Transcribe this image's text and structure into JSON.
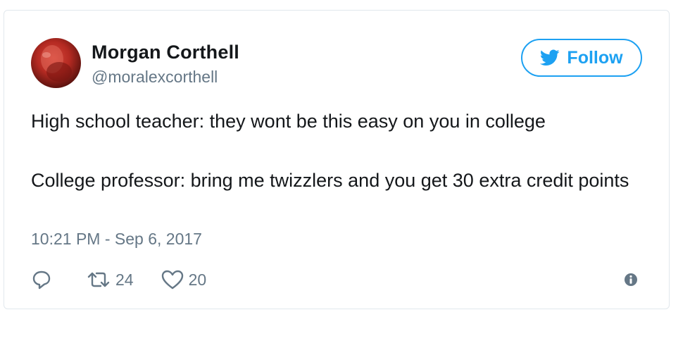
{
  "tweet": {
    "author": {
      "display_name": "Morgan Corthell",
      "screen_name": "@moralexcorthell"
    },
    "follow_label": "Follow",
    "text": {
      "line1": "High school teacher: they wont be this easy on you in college",
      "line2": "College professor: bring me twizzlers and you get 30 extra credit points"
    },
    "timestamp": "10:21 PM - Sep 6, 2017",
    "actions": {
      "retweet_count": "24",
      "like_count": "20"
    }
  },
  "colors": {
    "accent": "#1da1f2",
    "muted": "#657786",
    "text": "#14171a",
    "border": "#e1e8ed"
  }
}
